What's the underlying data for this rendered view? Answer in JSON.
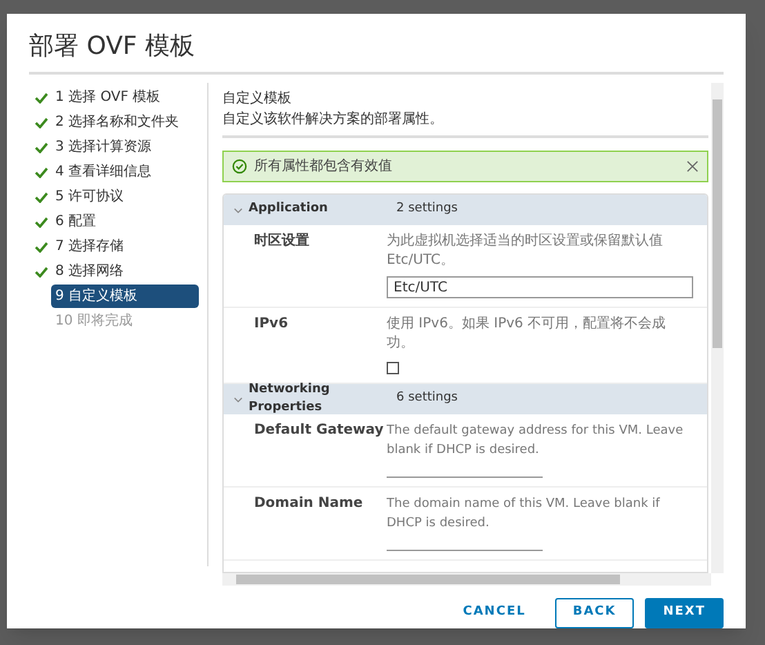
{
  "dialog": {
    "title": "部署 OVF 模板"
  },
  "steps": [
    {
      "label": "1 选择 OVF 模板",
      "completed": true,
      "selected": false
    },
    {
      "label": "2 选择名称和文件夹",
      "completed": true,
      "selected": false
    },
    {
      "label": "3 选择计算资源",
      "completed": true,
      "selected": false
    },
    {
      "label": "4 查看详细信息",
      "completed": true,
      "selected": false
    },
    {
      "label": "5 许可协议",
      "completed": true,
      "selected": false
    },
    {
      "label": "6 配置",
      "completed": true,
      "selected": false
    },
    {
      "label": "7 选择存储",
      "completed": true,
      "selected": false
    },
    {
      "label": "8 选择网络",
      "completed": true,
      "selected": false
    },
    {
      "label": "9 自定义模板",
      "completed": false,
      "selected": true
    },
    {
      "label": "10 即将完成",
      "completed": false,
      "selected": false
    }
  ],
  "page": {
    "title": "自定义模板",
    "subtitle": "自定义该软件解决方案的部署属性。"
  },
  "alert": {
    "message": "所有属性都包含有效值"
  },
  "groups": [
    {
      "name": "Application",
      "count": "2 settings",
      "expanded": true,
      "settings": [
        {
          "kind": "text",
          "label": "时区设置",
          "description": "为此虚拟机选择适当的时区设置或保留默认值 Etc/UTC。",
          "value": "Etc/UTC"
        },
        {
          "kind": "checkbox",
          "label": "IPv6",
          "description": "使用 IPv6。如果 IPv6 不可用，配置将不会成功。",
          "checked": false
        }
      ]
    },
    {
      "name": "Networking Properties",
      "count": "6 settings",
      "expanded": true,
      "settings": [
        {
          "kind": "line",
          "label": "Default Gateway",
          "description": "The default gateway address for this VM. Leave blank if DHCP is desired."
        },
        {
          "kind": "line",
          "label": "Domain Name",
          "description": "The domain name of this VM. Leave blank if DHCP is desired."
        }
      ]
    }
  ],
  "buttons": [
    {
      "label": "CANCEL",
      "kind": "link"
    },
    {
      "label": "BACK",
      "kind": "outline"
    },
    {
      "label": "NEXT",
      "kind": "primary"
    }
  ]
}
